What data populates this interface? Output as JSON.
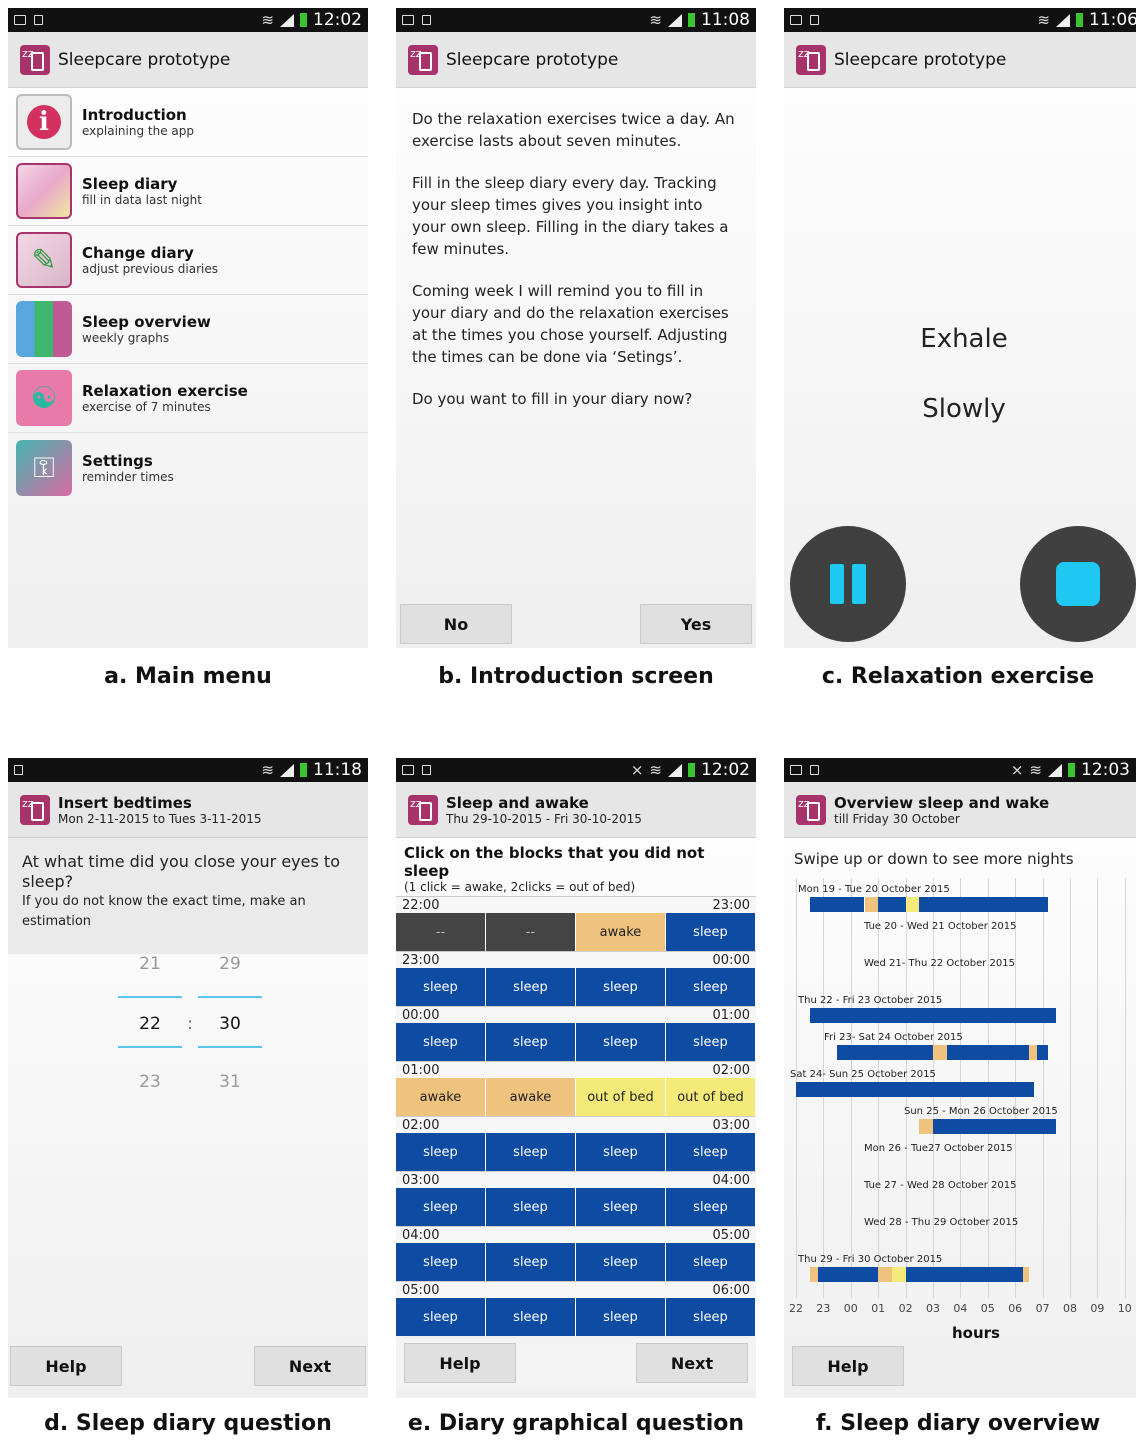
{
  "status_times": {
    "a": "12:02",
    "b": "11:08",
    "c": "11:06",
    "d": "11:18",
    "e": "12:02",
    "f": "12:03"
  },
  "app_title": "Sleepcare prototype",
  "menu": [
    {
      "label": "Introduction",
      "sub": "explaining the app"
    },
    {
      "label": "Sleep diary",
      "sub": "fill in data last night"
    },
    {
      "label": "Change diary",
      "sub": "adjust previous diaries"
    },
    {
      "label": "Sleep overview",
      "sub": "weekly graphs"
    },
    {
      "label": "Relaxation exercise",
      "sub": "exercise of 7 minutes"
    },
    {
      "label": "Settings",
      "sub": "reminder times"
    }
  ],
  "intro": {
    "paragraphs": [
      "Do the relaxation exercises twice a day. An exercise lasts about seven minutes.",
      "Fill in the sleep diary every day. Tracking your sleep times gives you insight into your own sleep. Filling in the diary takes a few minutes.",
      "Coming week I will remind you to fill in your diary and do the relaxation exercises at the times you chose yourself. Adjusting the times can be done via ‘Setings’.",
      "Do you want to fill in your diary now?"
    ],
    "no": "No",
    "yes": "Yes"
  },
  "relax": {
    "line1": "Exhale",
    "line2": "Slowly"
  },
  "bedtimes": {
    "title": "Insert bedtimes",
    "subtitle": "Mon 2-11-2015 to Tues 3-11-2015",
    "question": "At what time did you close your eyes to sleep?",
    "hint": "If you do not know the exact time, make an estimation",
    "hours": [
      "21",
      "22",
      "23"
    ],
    "minutes": [
      "29",
      "30",
      "31"
    ],
    "sep": ":",
    "help": "Help",
    "next": "Next"
  },
  "diary": {
    "title": "Sleep and awake",
    "subtitle": "Thu 29-10-2015 - Fri 30-10-2015",
    "heading": "Click on the blocks that you did not sleep",
    "hint": "(1 click = awake, 2clicks = out of bed)",
    "rows": [
      {
        "from": "22:00",
        "to": "23:00",
        "cells": [
          "--",
          "--",
          "awake",
          "sleep"
        ]
      },
      {
        "from": "23:00",
        "to": "00:00",
        "cells": [
          "sleep",
          "sleep",
          "sleep",
          "sleep"
        ]
      },
      {
        "from": "00:00",
        "to": "01:00",
        "cells": [
          "sleep",
          "sleep",
          "sleep",
          "sleep"
        ]
      },
      {
        "from": "01:00",
        "to": "02:00",
        "cells": [
          "awake",
          "awake",
          "out of bed",
          "out of bed"
        ]
      },
      {
        "from": "02:00",
        "to": "03:00",
        "cells": [
          "sleep",
          "sleep",
          "sleep",
          "sleep"
        ]
      },
      {
        "from": "03:00",
        "to": "04:00",
        "cells": [
          "sleep",
          "sleep",
          "sleep",
          "sleep"
        ]
      },
      {
        "from": "04:00",
        "to": "05:00",
        "cells": [
          "sleep",
          "sleep",
          "sleep",
          "sleep"
        ]
      },
      {
        "from": "05:00",
        "to": "06:00",
        "cells": [
          "sleep",
          "sleep",
          "sleep",
          "sleep"
        ]
      }
    ],
    "help": "Help",
    "next": "Next"
  },
  "overview": {
    "title": "Overview sleep and wake",
    "subtitle": "till Friday 30 October",
    "hint": "Swipe up or down to see more nights",
    "nights": [
      {
        "label": "Mon 19 - Tue 20 October 2015"
      },
      {
        "label": "Tue 20 - Wed 21 October 2015"
      },
      {
        "label": "Wed 21- Thu 22 October 2015"
      },
      {
        "label": "Thu 22 - Fri 23 October 2015"
      },
      {
        "label": "Fri 23- Sat 24 October 2015"
      },
      {
        "label": "Sat 24- Sun 25 October 2015"
      },
      {
        "label": "Sun 25 - Mon 26 October 2015"
      },
      {
        "label": "Mon 26 - Tue27 October 2015"
      },
      {
        "label": "Tue 27 - Wed 28 October 2015"
      },
      {
        "label": "Wed 28 - Thu 29 October 2015"
      },
      {
        "label": "Thu 29 - Fri 30 October 2015"
      }
    ],
    "ticks": [
      "22",
      "23",
      "00",
      "01",
      "02",
      "03",
      "04",
      "05",
      "06",
      "07",
      "08",
      "09",
      "10"
    ],
    "xlabel": "hours",
    "help": "Help"
  },
  "captions": {
    "a": "a. Main menu",
    "b": "b. Introduction screen",
    "c": "c. Relaxation exercise",
    "d": "d. Sleep diary question",
    "e": "e. Diary graphical question",
    "f": "f. Sleep diary overview"
  },
  "colors": {
    "sleep": "#0e4ca3",
    "awake": "#efc27d",
    "out_of_bed": "#f4ea7a",
    "accent": "#1ec9f2",
    "app": "#a8336b"
  }
}
